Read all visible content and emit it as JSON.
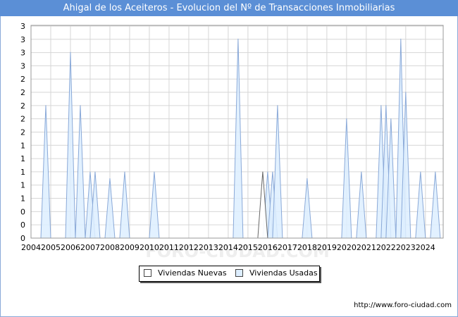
{
  "title": "Ahigal de los Aceiteros - Evolucion del Nº de Transacciones Inmobiliarias",
  "footer": "http://www.foro-ciudad.com",
  "watermark": "FORO-CIUDAD.COM",
  "colors": {
    "title_bg": "#5b8fd6",
    "usadas_fill": "#ddeeff",
    "usadas_stroke": "#8aa9d8",
    "nuevas_fill": "#ffffff",
    "nuevas_stroke": "#666666",
    "grid": "#d6d6d6"
  },
  "legend": [
    {
      "label": "Viviendas Nuevas",
      "color": "#ffffff"
    },
    {
      "label": "Viviendas Usadas",
      "color": "#ddeeff"
    }
  ],
  "chart_data": {
    "type": "area",
    "x_ticks": [
      "2004",
      "2005",
      "2006",
      "2007",
      "2008",
      "2009",
      "2010",
      "2011",
      "2012",
      "2013",
      "2014",
      "2015",
      "2016",
      "2017",
      "2018",
      "2019",
      "2020",
      "2021",
      "2022",
      "2023",
      "2024"
    ],
    "y_tick_labels": [
      "0",
      "0",
      "0",
      "1",
      "1",
      "1",
      "1",
      "1",
      "2",
      "2",
      "2",
      "2",
      "2",
      "3",
      "3",
      "3",
      "3"
    ],
    "ylim": [
      0,
      3.2
    ],
    "grid": true,
    "legend_position": "bottom-center",
    "series": [
      {
        "name": "Viviendas Usadas",
        "peaks": [
          {
            "x": 2004.75,
            "y": 2.0,
            "w": 0.25
          },
          {
            "x": 2006.0,
            "y": 2.8,
            "w": 0.25
          },
          {
            "x": 2006.5,
            "y": 2.0,
            "w": 0.25
          },
          {
            "x": 2007.0,
            "y": 1.0,
            "w": 0.25
          },
          {
            "x": 2007.25,
            "y": 1.0,
            "w": 0.25
          },
          {
            "x": 2008.0,
            "y": 0.9,
            "w": 0.25
          },
          {
            "x": 2008.75,
            "y": 1.0,
            "w": 0.25
          },
          {
            "x": 2010.25,
            "y": 1.0,
            "w": 0.25
          },
          {
            "x": 2014.5,
            "y": 3.0,
            "w": 0.25
          },
          {
            "x": 2016.0,
            "y": 1.0,
            "w": 0.25
          },
          {
            "x": 2016.25,
            "y": 1.0,
            "w": 0.25
          },
          {
            "x": 2016.5,
            "y": 2.0,
            "w": 0.25
          },
          {
            "x": 2018.0,
            "y": 0.9,
            "w": 0.25
          },
          {
            "x": 2020.0,
            "y": 1.8,
            "w": 0.25
          },
          {
            "x": 2020.75,
            "y": 1.0,
            "w": 0.25
          },
          {
            "x": 2021.75,
            "y": 2.0,
            "w": 0.25
          },
          {
            "x": 2022.0,
            "y": 2.0,
            "w": 0.25
          },
          {
            "x": 2022.25,
            "y": 1.8,
            "w": 0.25
          },
          {
            "x": 2022.75,
            "y": 3.0,
            "w": 0.25
          },
          {
            "x": 2023.0,
            "y": 2.2,
            "w": 0.25
          },
          {
            "x": 2023.75,
            "y": 1.0,
            "w": 0.25
          },
          {
            "x": 2024.5,
            "y": 1.0,
            "w": 0.25
          }
        ]
      },
      {
        "name": "Viviendas Nuevas",
        "peaks": [
          {
            "x": 2015.75,
            "y": 1.0,
            "w": 0.25
          }
        ]
      }
    ]
  }
}
